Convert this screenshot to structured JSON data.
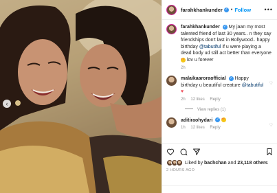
{
  "post": {
    "author": "farahkhankunder",
    "follow_label": "Follow",
    "dot": "•",
    "more_icon": "more-horizontal-icon"
  },
  "caption": {
    "author": "farahkhankunder",
    "text_1": "My jaan my most talented friend of last 30 years.. n they say friendships don't last in Bollywood.. happy birthday",
    "mention_1": "@tabutiful",
    "text_2": "if u were playing a dead body ud still act better than everyone",
    "text_3": "lov u forever",
    "time": "2h"
  },
  "comments": [
    {
      "author": "malaikaaroraofficial",
      "text": "Happy birthday u beautiful creature",
      "mention": "@tabutiful",
      "time": "2h",
      "likes": "12 likes",
      "reply": "Reply"
    },
    {
      "author": "aditiraohydari",
      "time": "1h",
      "likes": "12 likes",
      "reply": "Reply"
    }
  ],
  "view_replies": "View replies (1)",
  "likes": {
    "prefix": "Liked by",
    "user": "bachchan",
    "conj": "and",
    "count": "23,118 others"
  },
  "time_ago": "2 HOURS AGO",
  "icons": [
    "heart-icon",
    "comment-icon",
    "share-icon",
    "bookmark-icon"
  ]
}
